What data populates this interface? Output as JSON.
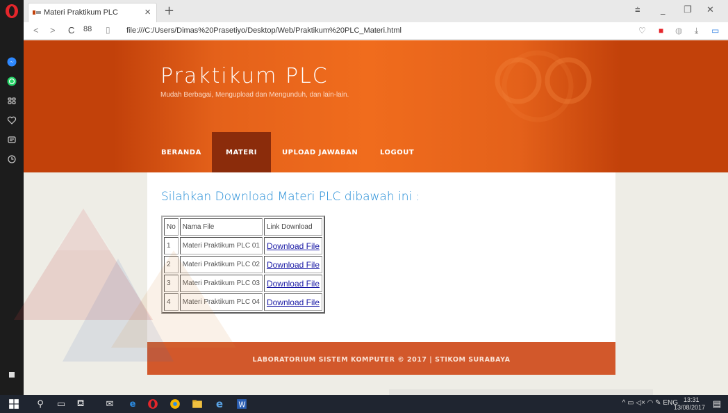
{
  "browser": {
    "tab_title": "Materi Praktikum PLC",
    "tab_close": "×",
    "new_tab": "+",
    "url": "file:///C:/Users/Dimas%20Prasetiyo/Desktop/Web/Praktikum%20PLC_Materi.html"
  },
  "site": {
    "title": "Praktikum PLC",
    "tagline": "Mudah Berbagai, Mengupload dan Mengunduh, dan lain-lain."
  },
  "nav": [
    {
      "label": "BERANDA",
      "active": false
    },
    {
      "label": "MATERI",
      "active": true
    },
    {
      "label": "UPLOAD JAWABAN",
      "active": false
    },
    {
      "label": "LOGOUT",
      "active": false
    }
  ],
  "content": {
    "heading": "Silahkan Download Materi PLC dibawah ini :"
  },
  "table": {
    "headers": [
      "No",
      "Nama File",
      "Link Download"
    ],
    "rows": [
      {
        "no": "1",
        "name": "Materi Praktikum PLC 01",
        "link": "Download File"
      },
      {
        "no": "2",
        "name": "Materi Praktikum PLC 02",
        "link": "Download File"
      },
      {
        "no": "3",
        "name": "Materi Praktikum PLC 03",
        "link": "Download File"
      },
      {
        "no": "4",
        "name": "Materi Praktikum PLC 04",
        "link": "Download File"
      }
    ]
  },
  "footer": {
    "text": "LABORATORIUM SISTEM KOMPUTER © 2017 | STIKOM SURABAYA"
  },
  "taskbar": {
    "language": "ENG",
    "time": "13:31",
    "date": "13/08/2017"
  },
  "colors": {
    "header": "#c2410a",
    "header_center": "#f06c1d",
    "nav_active": "#8b2c0b",
    "heading": "#1e8ad6",
    "footer": "#d2582b",
    "page_bg": "#eeede6"
  }
}
